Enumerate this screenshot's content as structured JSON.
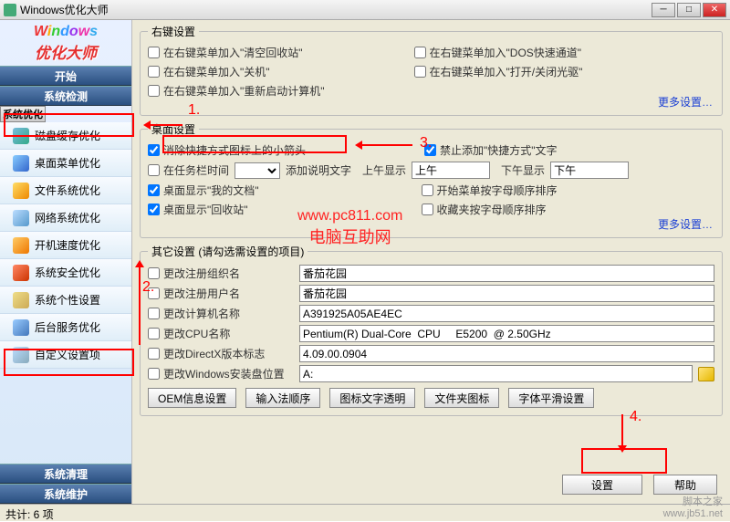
{
  "titlebar": {
    "title": "Windows优化大师"
  },
  "brand": {
    "line1_chars": [
      "W",
      "i",
      "n",
      "d",
      "o",
      "w",
      "s"
    ],
    "line2": "优化大师"
  },
  "sidebar": {
    "top": [
      {
        "label": "开始"
      },
      {
        "label": "系统检测"
      },
      {
        "label": "系统优化",
        "selected": true
      }
    ],
    "items": [
      {
        "label": "磁盘缓存优化"
      },
      {
        "label": "桌面菜单优化"
      },
      {
        "label": "文件系统优化"
      },
      {
        "label": "网络系统优化"
      },
      {
        "label": "开机速度优化"
      },
      {
        "label": "系统安全优化"
      },
      {
        "label": "系统个性设置"
      },
      {
        "label": "后台服务优化"
      },
      {
        "label": "自定义设置项"
      }
    ],
    "bottom": [
      {
        "label": "系统清理"
      },
      {
        "label": "系统维护"
      }
    ]
  },
  "groups": {
    "rightClick": {
      "legend": "右键设置",
      "chks": [
        "在右键菜单加入\"清空回收站\"",
        "在右键菜单加入\"DOS快速通道\"",
        "在右键菜单加入\"关机\"",
        "在右键菜单加入\"打开/关闭光驱\"",
        "在右键菜单加入\"重新启动计算机\""
      ],
      "more": "更多设置…"
    },
    "desktop": {
      "legend": "桌面设置",
      "chk_removearrow": "消除快捷方式图标上的小箭头",
      "chk_prohibit": "禁止添加\"快捷方式\"文字",
      "chk_taskbar": "在任务栏时间",
      "lbl_adddesc": "添加说明文字",
      "lbl_amshow": "上午显示",
      "val_am": "上午",
      "lbl_pmshow": "下午显示",
      "val_pm": "下午",
      "chk_mydoc": "桌面显示\"我的文档\"",
      "chk_startsort": "开始菜单按字母顺序排序",
      "chk_recycle": "桌面显示\"回收站\"",
      "chk_favsort": "收藏夹按字母顺序排序",
      "more": "更多设置…"
    },
    "other": {
      "legend": "其它设置 (请勾选需设置的项目)",
      "rows": [
        {
          "label": "更改注册组织名",
          "value": "番茄花园"
        },
        {
          "label": "更改注册用户名",
          "value": "番茄花园"
        },
        {
          "label": "更改计算机名称",
          "value": "A391925A05AE4EC"
        },
        {
          "label": "更改CPU名称",
          "value": "Pentium(R) Dual-Core  CPU     E5200  @ 2.50GHz"
        },
        {
          "label": "更改DirectX版本标志",
          "value": "4.09.00.0904"
        },
        {
          "label": "更改Windows安装盘位置",
          "value": "A:"
        }
      ],
      "buttons": [
        "OEM信息设置",
        "输入法顺序",
        "图标文字透明",
        "文件夹图标",
        "字体平滑设置"
      ]
    }
  },
  "actions": {
    "set": "设置",
    "help": "帮助"
  },
  "status": "共计: 6 项",
  "annotations": {
    "n1": "1.",
    "n2": "2.",
    "n3": "3.",
    "n4": "4.",
    "wm1": "www.pc811.com",
    "wm2": "电脑互助网",
    "wm3": "脚本之家",
    "wm4": "www.jb51.net"
  }
}
